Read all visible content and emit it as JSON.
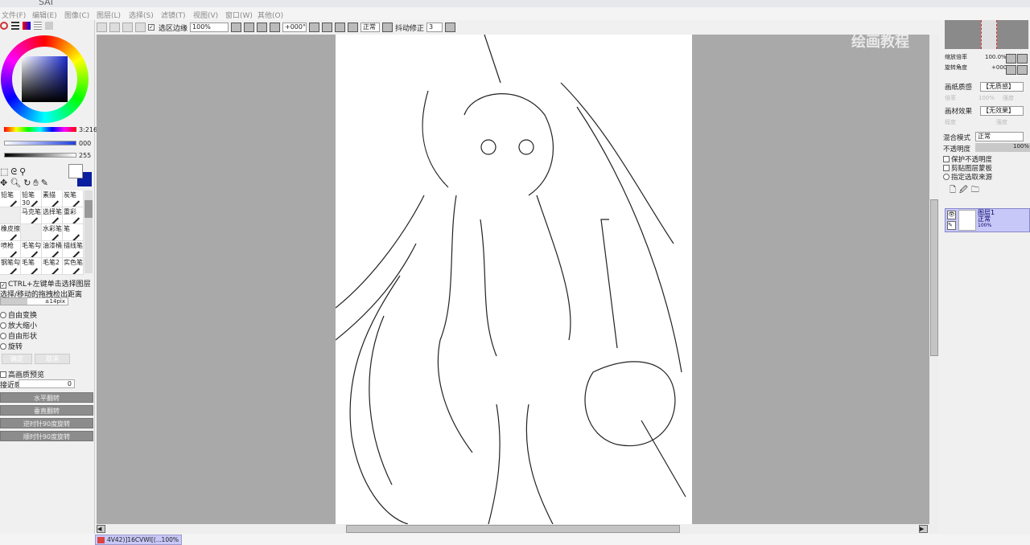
{
  "app": {
    "title": "SAI"
  },
  "menu": [
    "文件(F)",
    "编辑(E)",
    "图像(C)",
    "图层(L)",
    "选择(S)",
    "滤镜(T)",
    "视图(V)",
    "窗口(W)",
    "其他(O)"
  ],
  "toolbar": {
    "selection_edge": "选区边缘",
    "zoom": "100%",
    "rotation": "+000°",
    "mode": "正常",
    "stabilizer_label": "抖动修正",
    "stabilizer": "3"
  },
  "color": {
    "hue_value": "3:216",
    "sat_value": "000",
    "val_value": "255",
    "primary": "#ffffff",
    "secondary": "#0a1ea0"
  },
  "brushes": [
    "铅笔",
    "铅笔30",
    "素描",
    "炭笔",
    "",
    "马克笔",
    "选择笔",
    "重彩",
    "橡皮擦",
    "",
    "水彩笔",
    "笔",
    "喷枪",
    "毛笔勾",
    "油漆桶",
    "描线笔",
    "钢笔勾",
    "毛笔",
    "毛笔2",
    "实色笔"
  ],
  "tool_options": {
    "ctrl_select": "CTRL+左键单击选择图层",
    "detect_label": "选择/移动的拖拽检出距离",
    "detect_value": "±14pix",
    "modes": [
      "自由变换",
      "放大缩小",
      "自由形状",
      "旋转"
    ],
    "ok": "确定",
    "cancel": "取消",
    "hq_preview": "高画质预览",
    "proximity_label": "接近感",
    "proximity_value": "0",
    "buttons": [
      "水平翻转",
      "垂直翻转",
      "逆时针90度旋转",
      "顺时针90度旋转"
    ]
  },
  "right": {
    "zoom_label": "缩放倍率",
    "zoom_value": "100.0%",
    "angle_label": "旋转角度",
    "angle_value": "+000",
    "paper_label": "画纸质感",
    "paper_value": "【无质感】",
    "paper_scale": "倍率",
    "paper_scale_val": "100%",
    "paper_strength": "强度",
    "effect_label": "画材效果",
    "effect_value": "【无效果】",
    "effect_width": "程度",
    "effect_strength": "强度",
    "blend_label": "混合模式",
    "blend_value": "正常",
    "opacity_label": "不透明度",
    "opacity_value": "100%",
    "checks": [
      "保护不透明度",
      "剪贴图层蒙板",
      "指定选取来源"
    ],
    "layer": {
      "name": "图层1",
      "mode": "正常",
      "opacity": "100%"
    }
  },
  "watermark": "绘画教程",
  "status": {
    "tab": "4V42)]16CVWI[(...",
    "zoom": "100%"
  }
}
